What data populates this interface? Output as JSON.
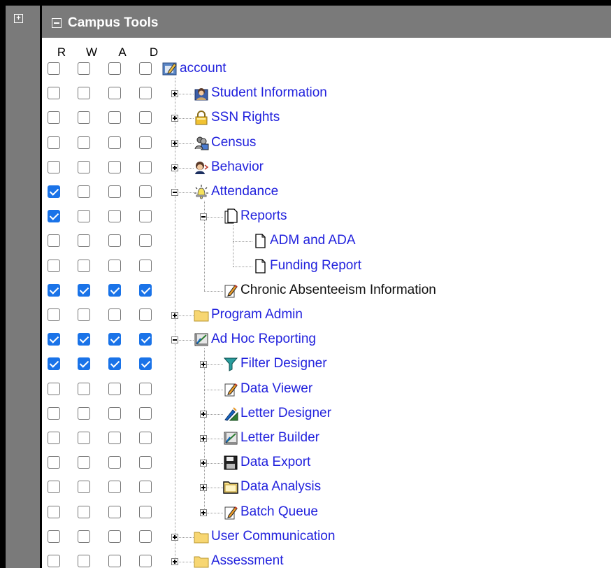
{
  "header": {
    "title": "Campus Tools"
  },
  "columns": [
    "R",
    "W",
    "A",
    "D"
  ],
  "rows": [
    {
      "label": "account",
      "icon": "account-icon",
      "depth": 0,
      "toggle": "none",
      "link": true,
      "checks": [
        false,
        false,
        false,
        false
      ]
    },
    {
      "label": "Student Information",
      "icon": "student-info-icon",
      "depth": 1,
      "toggle": "plus",
      "link": true,
      "checks": [
        false,
        false,
        false,
        false
      ]
    },
    {
      "label": "SSN Rights",
      "icon": "lock-icon",
      "depth": 1,
      "toggle": "plus",
      "link": true,
      "checks": [
        false,
        false,
        false,
        false
      ]
    },
    {
      "label": "Census",
      "icon": "census-icon",
      "depth": 1,
      "toggle": "plus",
      "link": true,
      "checks": [
        false,
        false,
        false,
        false
      ]
    },
    {
      "label": "Behavior",
      "icon": "behavior-icon",
      "depth": 1,
      "toggle": "plus",
      "link": true,
      "checks": [
        false,
        false,
        false,
        false
      ]
    },
    {
      "label": "Attendance",
      "icon": "attendance-bell-icon",
      "depth": 1,
      "toggle": "minus",
      "link": true,
      "checks": [
        true,
        false,
        false,
        false
      ]
    },
    {
      "label": "Reports",
      "icon": "documents-icon",
      "depth": 2,
      "toggle": "minus",
      "link": true,
      "checks": [
        true,
        false,
        false,
        false
      ]
    },
    {
      "label": "ADM and ADA",
      "icon": "document-icon",
      "depth": 3,
      "toggle": "none",
      "link": true,
      "checks": [
        false,
        false,
        false,
        false
      ]
    },
    {
      "label": "Funding Report",
      "icon": "document-icon",
      "depth": 3,
      "toggle": "none",
      "link": true,
      "checks": [
        false,
        false,
        false,
        false
      ]
    },
    {
      "label": "Chronic Absenteeism Information",
      "icon": "edit-document-icon",
      "depth": 2,
      "toggle": "none",
      "link": false,
      "checks": [
        true,
        true,
        true,
        true
      ]
    },
    {
      "label": "Program Admin",
      "icon": "folder-icon",
      "depth": 1,
      "toggle": "plus",
      "link": true,
      "checks": [
        false,
        false,
        false,
        false
      ]
    },
    {
      "label": "Ad Hoc Reporting",
      "icon": "chart-icon",
      "depth": 1,
      "toggle": "minus",
      "link": true,
      "checks": [
        true,
        true,
        true,
        true
      ]
    },
    {
      "label": "Filter Designer",
      "icon": "filter-icon",
      "depth": 2,
      "toggle": "plus",
      "link": true,
      "checks": [
        true,
        true,
        true,
        true
      ]
    },
    {
      "label": "Data Viewer",
      "icon": "edit-document-icon",
      "depth": 2,
      "toggle": "none",
      "link": true,
      "checks": [
        false,
        false,
        false,
        false
      ]
    },
    {
      "label": "Letter Designer",
      "icon": "letter-designer-icon",
      "depth": 2,
      "toggle": "plus",
      "link": true,
      "checks": [
        false,
        false,
        false,
        false
      ]
    },
    {
      "label": "Letter Builder",
      "icon": "chart-icon",
      "depth": 2,
      "toggle": "plus",
      "link": true,
      "checks": [
        false,
        false,
        false,
        false
      ]
    },
    {
      "label": "Data Export",
      "icon": "floppy-disk-icon",
      "depth": 2,
      "toggle": "plus",
      "link": true,
      "checks": [
        false,
        false,
        false,
        false
      ]
    },
    {
      "label": "Data Analysis",
      "icon": "open-folder-icon",
      "depth": 2,
      "toggle": "plus",
      "link": true,
      "checks": [
        false,
        false,
        false,
        false
      ]
    },
    {
      "label": "Batch Queue",
      "icon": "edit-document-icon",
      "depth": 2,
      "toggle": "plus",
      "link": true,
      "checks": [
        false,
        false,
        false,
        false
      ]
    },
    {
      "label": "User Communication",
      "icon": "folder-icon",
      "depth": 1,
      "toggle": "plus",
      "link": true,
      "checks": [
        false,
        false,
        false,
        false
      ]
    },
    {
      "label": "Assessment",
      "icon": "folder-icon",
      "depth": 1,
      "toggle": "plus",
      "link": true,
      "checks": [
        false,
        false,
        false,
        false
      ]
    }
  ],
  "colors": {
    "link": "#2222dd",
    "checked": "#1a73e8",
    "header_bg": "#7a7a7a"
  }
}
